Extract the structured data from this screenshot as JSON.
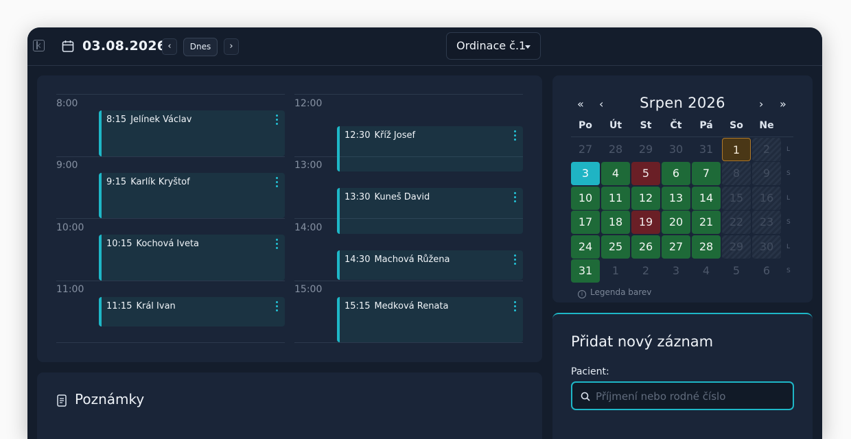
{
  "topbar": {
    "date": "03.08.2026",
    "today_label": "Dnes",
    "prev_label": "‹",
    "next_label": "›",
    "office": "Ordinace č.1"
  },
  "schedule": {
    "left_hours": [
      "8:00",
      "9:00",
      "10:00",
      "11:00"
    ],
    "right_hours": [
      "12:00",
      "13:00",
      "14:00",
      "15:00"
    ],
    "left_appointments": [
      {
        "time": "8:15",
        "name": "Jelínek Václav"
      },
      {
        "time": "9:15",
        "name": "Karlík Kryštof"
      },
      {
        "time": "10:15",
        "name": "Kochová Iveta"
      },
      {
        "time": "11:15",
        "name": "Král Ivan"
      }
    ],
    "right_appointments": [
      {
        "time": "12:30",
        "name": "Kříž Josef"
      },
      {
        "time": "13:30",
        "name": "Kuneš David"
      },
      {
        "time": "14:30",
        "name": "Machová Růžena"
      },
      {
        "time": "15:15",
        "name": "Medková Renata"
      }
    ]
  },
  "notes": {
    "title": "Poznámky"
  },
  "calendar": {
    "title": "Srpen 2026",
    "nav": {
      "first": "«",
      "prev": "‹",
      "next": "›",
      "last": "»"
    },
    "weekdays": [
      "Po",
      "Út",
      "St",
      "Čt",
      "Pá",
      "So",
      "Ne"
    ],
    "week_markers": [
      "L",
      "S",
      "L",
      "S",
      "L",
      "S"
    ],
    "weeks": [
      [
        "27",
        "28",
        "29",
        "30",
        "31",
        "1",
        "2"
      ],
      [
        "3",
        "4",
        "5",
        "6",
        "7",
        "8",
        "9"
      ],
      [
        "10",
        "11",
        "12",
        "13",
        "14",
        "15",
        "16"
      ],
      [
        "17",
        "18",
        "19",
        "20",
        "21",
        "22",
        "23"
      ],
      [
        "24",
        "25",
        "26",
        "27",
        "28",
        "29",
        "30"
      ],
      [
        "31",
        "1",
        "2",
        "3",
        "4",
        "5",
        "6"
      ]
    ],
    "states": [
      [
        "out",
        "out",
        "out",
        "out",
        "out",
        "holiday",
        "hatch"
      ],
      [
        "today",
        "green",
        "red",
        "green",
        "green",
        "hatch",
        "hatch"
      ],
      [
        "green",
        "green",
        "green",
        "green",
        "green",
        "hatch",
        "hatch"
      ],
      [
        "green",
        "green",
        "red",
        "green",
        "green",
        "hatch",
        "hatch"
      ],
      [
        "green",
        "green",
        "green",
        "green",
        "green",
        "hatch",
        "hatch"
      ],
      [
        "green",
        "out",
        "out",
        "out",
        "out",
        "out",
        "out"
      ]
    ],
    "colors": {
      "free": "#1e6a38",
      "full": "#6a1f26",
      "today": "#1fb4c4",
      "holiday": "#b07a2a"
    },
    "legend": "Legenda barev"
  },
  "add_record": {
    "title": "Přidat nový záznam",
    "patient_label": "Pacient:",
    "patient_placeholder": "Příjmení nebo rodné číslo"
  }
}
